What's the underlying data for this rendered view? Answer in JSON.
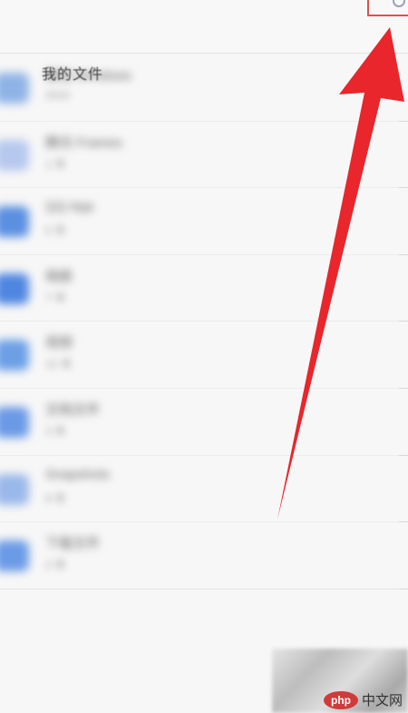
{
  "header": {
    "highlight_icon": "circle-icon",
    "highlight_color": "#d9534f"
  },
  "list": {
    "title": "我的文件",
    "items": [
      {
        "name": "微信 Windows",
        "meta": "2023",
        "icon_color": "#8fb3e6"
      },
      {
        "name": "腾讯 Frames",
        "meta": "1 项",
        "icon_color": "#b6c8ee"
      },
      {
        "name": "QQ App",
        "meta": "5 项",
        "icon_color": "#5b8fe0"
      },
      {
        "name": "相册",
        "meta": "7 项",
        "icon_color": "#4f86e0"
      },
      {
        "name": "视频",
        "meta": "12 项",
        "icon_color": "#6d9fe6"
      },
      {
        "name": "文档文件",
        "meta": "3 项",
        "icon_color": "#6b99e6"
      },
      {
        "name": "Snapshots",
        "meta": "6 项",
        "icon_color": "#9ab8ea"
      },
      {
        "name": "下载文件",
        "meta": "2 项",
        "icon_color": "#6b9ae6"
      }
    ]
  },
  "annotation": {
    "arrow_color": "#e8262b"
  },
  "watermark": {
    "logo_text": "php",
    "site_text": "中文网",
    "logo_color": "#cf3b3b"
  }
}
